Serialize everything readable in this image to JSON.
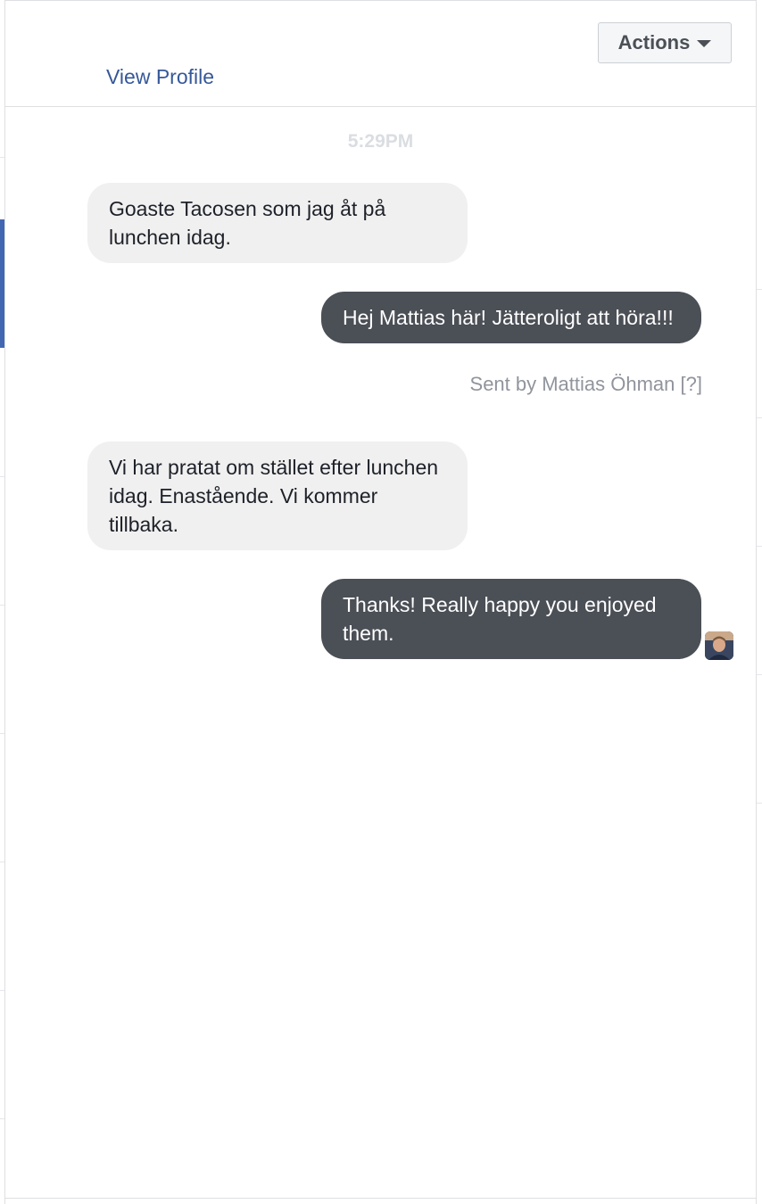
{
  "header": {
    "view_profile": "View Profile",
    "actions_label": "Actions"
  },
  "conversation": {
    "timestamp": "5:29PM",
    "messages": [
      {
        "direction": "incoming",
        "text": "Goaste Tacosen som jag åt på lunchen idag."
      },
      {
        "direction": "outgoing",
        "text": "Hej Mattias här! Jätteroligt att höra!!!"
      },
      {
        "direction": "incoming",
        "text": "Vi har pratat om stället efter lunchen idag. Enastående. Vi kommer tillbaka."
      },
      {
        "direction": "outgoing",
        "text": "Thanks! Really happy you enjoyed them."
      }
    ],
    "sent_by": "Sent by Mattias Öhman",
    "sent_by_help": "[?]"
  },
  "colors": {
    "link": "#365899",
    "outgoing_bubble": "#4b4f56",
    "incoming_bubble": "#f1f0f0",
    "accent": "#4267b2"
  },
  "icons": {
    "actions_caret": "caret-down-icon",
    "seen_avatar": "avatar"
  }
}
